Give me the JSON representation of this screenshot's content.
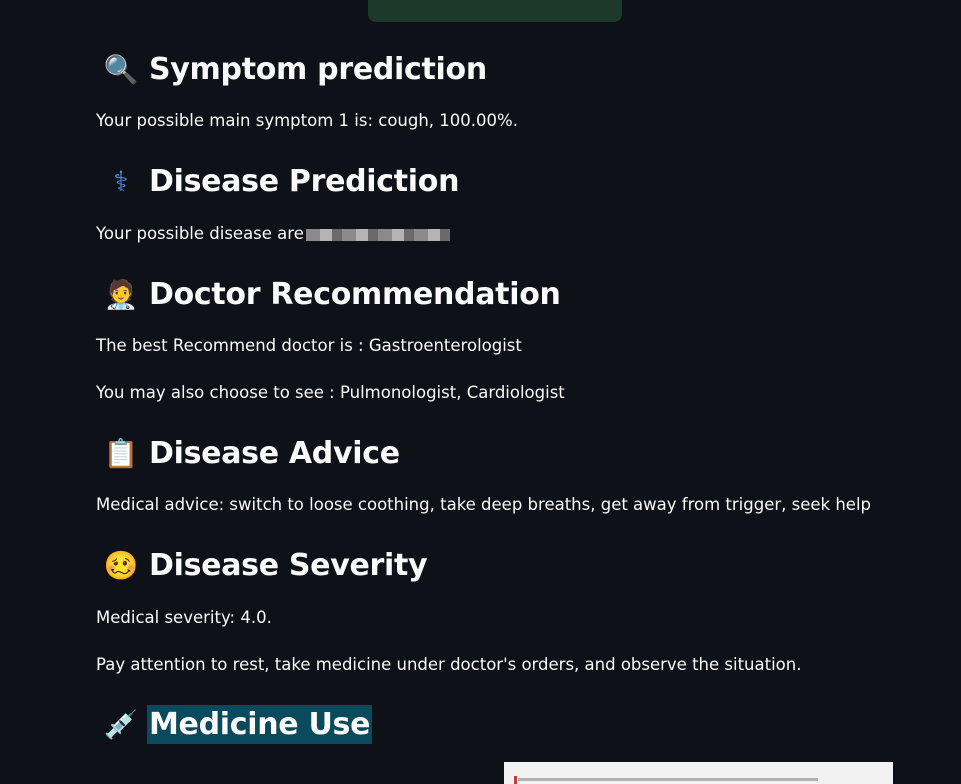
{
  "sections": [
    {
      "key": "symptom",
      "icon": "magnifier-icon",
      "icon_glyph": "🔍",
      "title": "Symptom prediction",
      "paragraphs": [
        "Your possible main symptom 1 is: cough, 100.00%."
      ]
    },
    {
      "key": "disease",
      "icon": "medical-symbol-icon",
      "icon_glyph": "⚕",
      "title": "Disease Prediction",
      "paragraphs": [
        "Your possible disease are"
      ]
    },
    {
      "key": "doctor",
      "icon": "doctor-icon",
      "icon_glyph": "🧑‍⚕️",
      "title": "Doctor Recommendation",
      "paragraphs": [
        "The best Recommend doctor is : Gastroenterologist",
        "You may also choose to see : Pulmonologist, Cardiologist"
      ]
    },
    {
      "key": "advice",
      "icon": "clipboard-icon",
      "icon_glyph": "📋",
      "title": "Disease Advice",
      "paragraphs": [
        "Medical advice: switch to loose coothing, take deep breaths, get away from trigger, seek help"
      ]
    },
    {
      "key": "severity",
      "icon": "dizzy-face-icon",
      "icon_glyph": "🥴",
      "title": "Disease Severity",
      "paragraphs": [
        "Medical severity: 4.0.",
        "Pay attention to rest, take medicine under doctor's orders, and observe the situation."
      ]
    },
    {
      "key": "medicine",
      "icon": "syringe-icon",
      "icon_glyph": "💉",
      "title": "Medicine Use",
      "paragraphs": []
    }
  ],
  "colors": {
    "background": "#0e1117",
    "text": "#fafafa",
    "highlight": "#0b4a5c",
    "top_button": "#1c3a2a"
  }
}
